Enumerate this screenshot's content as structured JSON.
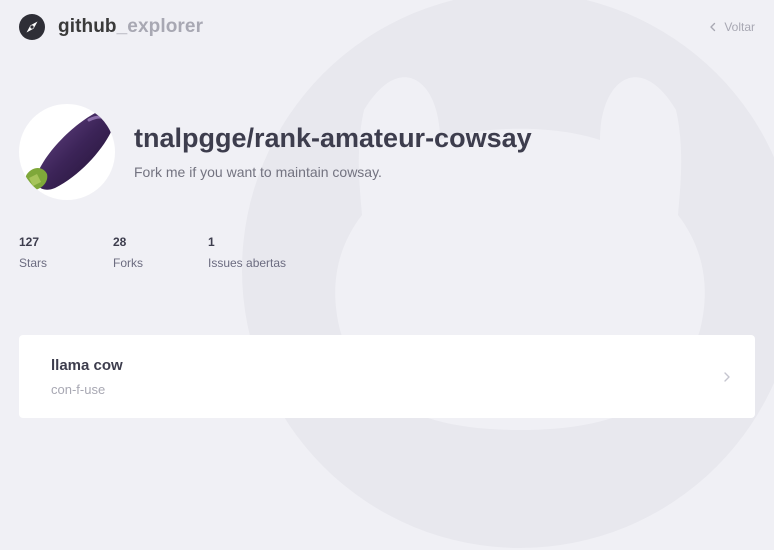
{
  "brand": {
    "name_primary": "github",
    "name_secondary": "_explorer",
    "icon": "compass-icon"
  },
  "nav": {
    "back_label": "Voltar",
    "back_icon": "chevron-left-icon"
  },
  "repository": {
    "full_name": "tnalpgge/rank-amateur-cowsay",
    "description": "Fork me if you want to maintain cowsay.",
    "avatar": "eggplant-avatar"
  },
  "stats": [
    {
      "value": "127",
      "label": "Stars"
    },
    {
      "value": "28",
      "label": "Forks"
    },
    {
      "value": "1",
      "label": "Issues abertas"
    }
  ],
  "issues": [
    {
      "title": "llama cow",
      "user": "con-f-use",
      "icon": "chevron-right-icon"
    }
  ],
  "colors": {
    "background": "#f0f0f5",
    "text_dark": "#3d3d4d",
    "text_muted": "#a8a8b3",
    "card": "#ffffff"
  }
}
